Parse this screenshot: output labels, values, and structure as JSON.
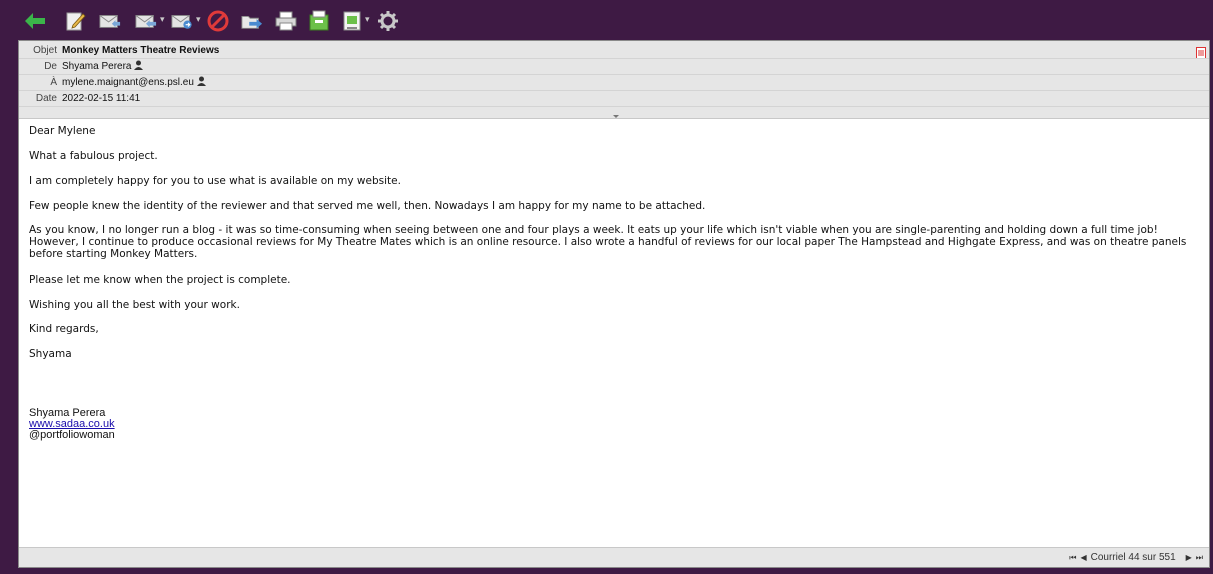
{
  "toolbar": {
    "icons": [
      {
        "name": "back-arrow-icon",
        "color": "#3bb54a"
      },
      {
        "name": "compose-icon",
        "color": "#e8e8e8"
      },
      {
        "name": "reply-icon",
        "color": "#d0d0d0"
      },
      {
        "name": "reply-all-icon",
        "color": "#d0d0d0"
      },
      {
        "name": "forward-icon",
        "color": "#d0d0d0"
      },
      {
        "name": "delete-icon",
        "color": "#e03a3a"
      },
      {
        "name": "move-folder-icon",
        "color": "#5aa0d8"
      },
      {
        "name": "print-icon",
        "color": "#d8d8d8"
      },
      {
        "name": "archive-icon",
        "color": "#6cc04a"
      },
      {
        "name": "download-icon",
        "color": "#6cc04a"
      },
      {
        "name": "settings-gear-icon",
        "color": "#c8c8c8"
      }
    ]
  },
  "headers": {
    "subject_label": "Objet",
    "subject": "Monkey Matters Theatre Reviews",
    "from_label": "De",
    "from": "Shyama Perera",
    "to_label": "À",
    "to": "mylene.maignant@ens.psl.eu",
    "date_label": "Date",
    "date": "2022-02-15 11:41"
  },
  "message": {
    "greeting": "Dear Mylene",
    "p1": "What a fabulous project.",
    "p2": "I am completely happy for you to use what is available on my website.",
    "p3": "Few people knew the identity of the reviewer and that served me well, then. Nowadays I am happy for my name to be attached.",
    "p4": "As you know, I no longer run a blog - it was so time-consuming when seeing between one and four plays a week. It eats up your life which isn't viable when you are single-parenting and holding down a full time job!  However, I continue to produce occasional reviews for My Theatre Mates which is an online resource. I also wrote a handful of reviews for our local paper The Hampstead and Highgate Express, and was on theatre panels before starting Monkey Matters.",
    "p5": "Please let me know when the project is complete.",
    "p6": "Wishing you all the best with your work.",
    "closing": "Kind regards,",
    "signoff": "Shyama",
    "sig_name": "Shyama Perera",
    "sig_link": "www.sadaa.co.uk",
    "sig_handle": "@portfoliowoman"
  },
  "footer": {
    "pager_text": "Courriel 44 sur 551"
  },
  "colors": {
    "chrome": "#3e1a44",
    "header_bg": "#e6e6e6",
    "link": "#1a0dab"
  }
}
